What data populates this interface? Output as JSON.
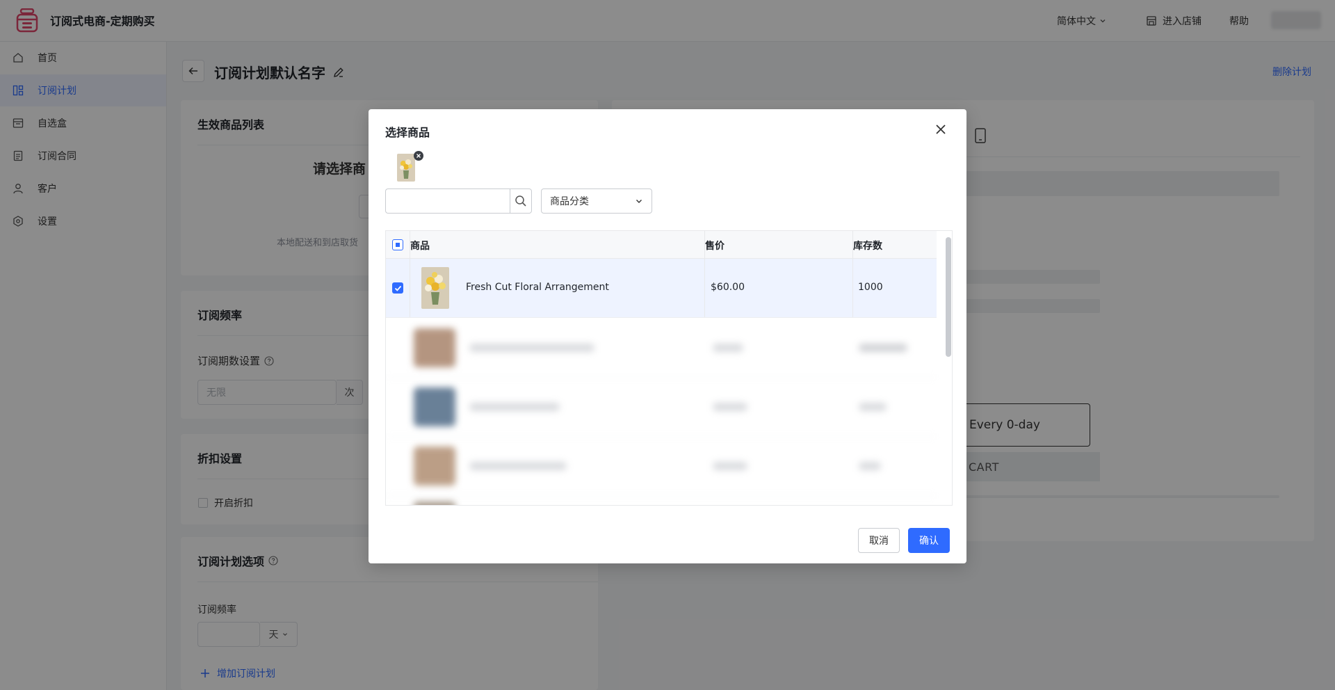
{
  "header": {
    "app_title": "订阅式电商-定期购买",
    "language": "简体中文",
    "enter_store": "进入店铺",
    "help": "帮助"
  },
  "sidebar": {
    "items": [
      {
        "label": "首页",
        "icon": "home-icon"
      },
      {
        "label": "订阅计划",
        "icon": "plan-icon",
        "active": true
      },
      {
        "label": "自选盒",
        "icon": "box-icon"
      },
      {
        "label": "订阅合同",
        "icon": "contract-icon"
      },
      {
        "label": "客户",
        "icon": "user-icon"
      },
      {
        "label": "设置",
        "icon": "settings-icon"
      }
    ]
  },
  "page": {
    "title": "订阅计划默认名字",
    "delete_plan": "删除计划"
  },
  "products_card": {
    "title": "生效商品列表",
    "prompt": "请选择商",
    "hint": "本地配送和到店取货"
  },
  "frequency_card": {
    "title": "订阅频率",
    "periods_label": "订阅期数设置",
    "periods_placeholder": "无限",
    "periods_suffix": "次"
  },
  "discount_card": {
    "title": "折扣设置",
    "enable_discount": "开启折扣"
  },
  "options_card": {
    "title": "订阅计划选项",
    "frequency_label": "订阅频率",
    "unit": "天",
    "add_plan": "增加订阅计划"
  },
  "preview": {
    "frequency_option": "Every 0-day",
    "cart_button": "CART"
  },
  "modal": {
    "title": "选择商品",
    "search_placeholder": "",
    "category_placeholder": "商品分类",
    "columns": {
      "product": "商品",
      "price": "售价",
      "stock": "库存数"
    },
    "rows": [
      {
        "name": "Fresh Cut Floral Arrangement",
        "price": "$60.00",
        "stock": "1000",
        "selected": true
      }
    ],
    "cancel": "取消",
    "confirm": "确认"
  },
  "colors": {
    "accent": "#2f6bff",
    "overlay": "rgba(0,0,0,0.45)",
    "selected_row": "#eef3ff"
  }
}
